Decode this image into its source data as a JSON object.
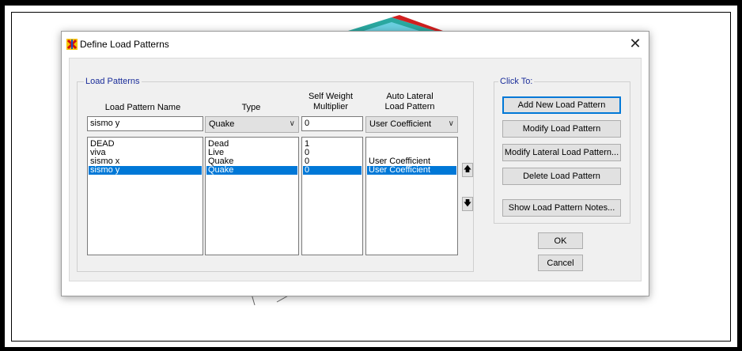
{
  "dialog": {
    "title": "Define Load Patterns",
    "close_glyph": "✕",
    "title_icon": "sap-logo-icon"
  },
  "load_patterns": {
    "group_label": "Load Patterns",
    "headers": {
      "name": "Load Pattern Name",
      "type": "Type",
      "self_weight_line1": "Self Weight",
      "self_weight_line2": "Multiplier",
      "auto_lateral_line1": "Auto Lateral",
      "auto_lateral_line2": "Load Pattern"
    },
    "edit_row": {
      "name": "sismo y",
      "type": "Quake",
      "multiplier": "0",
      "auto_lateral": "User Coefficient"
    },
    "rows": [
      {
        "name": "DEAD",
        "type": "Dead",
        "multiplier": "1",
        "auto_lateral": ""
      },
      {
        "name": "viva",
        "type": "Live",
        "multiplier": "0",
        "auto_lateral": ""
      },
      {
        "name": "sismo x",
        "type": "Quake",
        "multiplier": "0",
        "auto_lateral": "User Coefficient"
      },
      {
        "name": "sismo y",
        "type": "Quake",
        "multiplier": "0",
        "auto_lateral": "User Coefficient",
        "selected": true
      }
    ],
    "move_up_glyph": "🡅",
    "move_down_glyph": "🡇"
  },
  "click_to": {
    "group_label": "Click To:",
    "add_new": "Add New Load Pattern",
    "modify": "Modify Load Pattern",
    "modify_lateral": "Modify Lateral Load Pattern...",
    "delete": "Delete Load Pattern",
    "show_notes": "Show Load Pattern Notes..."
  },
  "ok_label": "OK",
  "cancel_label": "Cancel",
  "colors": {
    "selection": "#0078d7",
    "group_label": "#1a2d9a",
    "default_button_border": "#0078d7"
  }
}
